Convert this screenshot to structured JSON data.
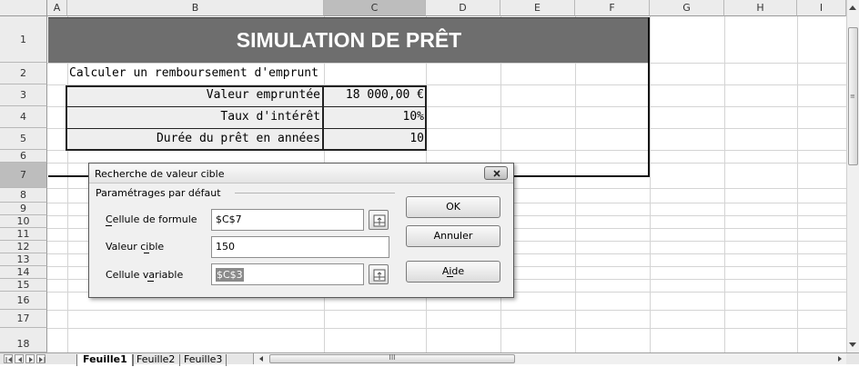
{
  "columns": [
    "A",
    "B",
    "C",
    "D",
    "E",
    "F",
    "G",
    "H",
    "I"
  ],
  "rows": [
    "1",
    "2",
    "3",
    "4",
    "5",
    "6",
    "7",
    "8",
    "9",
    "10",
    "11",
    "12",
    "13",
    "14",
    "15",
    "16",
    "17",
    "18"
  ],
  "sheet": {
    "title": "SIMULATION DE PRÊT",
    "subtitle": "Calculer un remboursement d'emprunt",
    "table": [
      {
        "label": "Valeur empruntée",
        "value": "18 000,00 €"
      },
      {
        "label": "Taux d'intérêt",
        "value": "10%"
      },
      {
        "label": "Durée du prêt en années",
        "value": "10"
      }
    ]
  },
  "dialog": {
    "title": "Recherche de valeur cible",
    "group_label": "Paramétrages par défaut",
    "formula_cell_label": "Cellule de formule",
    "formula_cell_value": "$C$7",
    "target_value_label": "Valeur cible",
    "target_value": "150",
    "variable_cell_label": "Cellule variable",
    "variable_cell_value": "$C$3",
    "ok_label": "OK",
    "cancel_label": "Annuler",
    "help_label": "Aide"
  },
  "tabs": [
    "Feuille1",
    "Feuille2",
    "Feuille3"
  ],
  "scroll_thumb_label": "III",
  "colors": {
    "title_bg": "#6e6e6e",
    "title_text": "#ffffff",
    "table_bg": "#eeeeee",
    "header_bg": "#ececec",
    "selected_header": "#bdbdbd"
  },
  "icons": [
    "shrink-icon",
    "close-icon",
    "scroll-up-icon",
    "scroll-down-icon",
    "scroll-left-icon",
    "scroll-right-icon"
  ]
}
